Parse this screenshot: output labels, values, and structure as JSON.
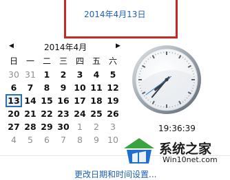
{
  "header": {
    "full_date": "2014年4月13日"
  },
  "calendar": {
    "month_title": "2014年4月",
    "weekdays": [
      "日",
      "一",
      "二",
      "三",
      "四",
      "五",
      "六"
    ],
    "weeks": [
      [
        {
          "d": "30",
          "cur": false
        },
        {
          "d": "31",
          "cur": false
        },
        {
          "d": "1",
          "cur": true
        },
        {
          "d": "2",
          "cur": true
        },
        {
          "d": "3",
          "cur": true
        },
        {
          "d": "4",
          "cur": true
        },
        {
          "d": "5",
          "cur": true
        }
      ],
      [
        {
          "d": "6",
          "cur": true
        },
        {
          "d": "7",
          "cur": true
        },
        {
          "d": "8",
          "cur": true
        },
        {
          "d": "9",
          "cur": true
        },
        {
          "d": "10",
          "cur": true
        },
        {
          "d": "11",
          "cur": true
        },
        {
          "d": "12",
          "cur": true
        }
      ],
      [
        {
          "d": "13",
          "cur": true,
          "today": true
        },
        {
          "d": "14",
          "cur": true
        },
        {
          "d": "15",
          "cur": true
        },
        {
          "d": "16",
          "cur": true
        },
        {
          "d": "17",
          "cur": true
        },
        {
          "d": "18",
          "cur": true
        },
        {
          "d": "19",
          "cur": true
        }
      ],
      [
        {
          "d": "20",
          "cur": true
        },
        {
          "d": "21",
          "cur": true
        },
        {
          "d": "22",
          "cur": true
        },
        {
          "d": "23",
          "cur": true
        },
        {
          "d": "24",
          "cur": true
        },
        {
          "d": "25",
          "cur": true
        },
        {
          "d": "26",
          "cur": true
        }
      ],
      [
        {
          "d": "27",
          "cur": true
        },
        {
          "d": "28",
          "cur": true
        },
        {
          "d": "29",
          "cur": true
        },
        {
          "d": "30",
          "cur": true
        },
        {
          "d": "1",
          "cur": false
        },
        {
          "d": "2",
          "cur": false
        },
        {
          "d": "3",
          "cur": false
        }
      ],
      [
        {
          "d": "4",
          "cur": false
        },
        {
          "d": "5",
          "cur": false
        },
        {
          "d": "6",
          "cur": false
        },
        {
          "d": "7",
          "cur": false
        },
        {
          "d": "8",
          "cur": false
        },
        {
          "d": "9",
          "cur": false
        },
        {
          "d": "10",
          "cur": false
        }
      ]
    ],
    "prev_icon": "triangle-left-icon",
    "next_icon": "triangle-right-icon"
  },
  "clock": {
    "time_text": "19:36:39"
  },
  "footer": {
    "link_text": "更改日期和时间设置..."
  },
  "watermark": {
    "title": "系统之家",
    "domain": "Win10net.com"
  },
  "colors": {
    "link": "#1e5fb4",
    "highlight_border": "#c62a26",
    "today_border": "#2a6db5"
  }
}
